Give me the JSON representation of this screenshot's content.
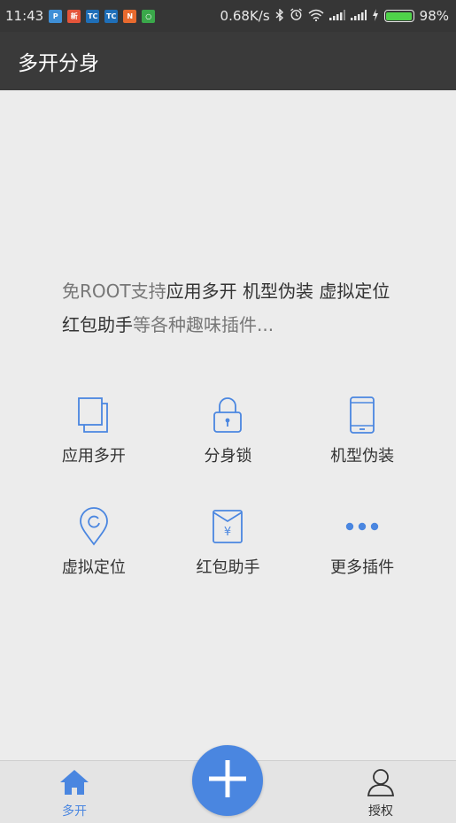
{
  "status_bar": {
    "time": "11:43",
    "net_speed": "0.68K/s",
    "battery_percent": "98%",
    "battery_level": 0.98,
    "notification_icons": [
      {
        "name": "pin-app-icon",
        "color": "#3f8fd6",
        "glyph": "P"
      },
      {
        "name": "news-app-icon",
        "color": "#e4543a",
        "glyph": "新"
      },
      {
        "name": "tc-app-icon",
        "color": "#1f6fb8",
        "glyph": "TC"
      },
      {
        "name": "tc-app-icon-2",
        "color": "#1f6fb8",
        "glyph": "TC"
      },
      {
        "name": "orange-app-icon",
        "color": "#e86a2e",
        "glyph": "N"
      },
      {
        "name": "green-app-icon",
        "color": "#3aa84a",
        "glyph": "○"
      }
    ]
  },
  "app_bar": {
    "title": "多开分身"
  },
  "intro": {
    "part1": "免ROOT支持",
    "part2": "应用多开 机型伪装 虚拟定位 红包助手",
    "part3": "等各种趣味插件..."
  },
  "features": [
    {
      "label": "应用多开",
      "icon": "copy-icon"
    },
    {
      "label": "分身锁",
      "icon": "lock-icon"
    },
    {
      "label": "机型伪装",
      "icon": "phone-icon"
    },
    {
      "label": "虚拟定位",
      "icon": "location-icon"
    },
    {
      "label": "红包助手",
      "icon": "red-envelope-icon"
    },
    {
      "label": "更多插件",
      "icon": "more-icon"
    }
  ],
  "bottom_nav": {
    "home_label": "多开",
    "auth_label": "授权"
  },
  "colors": {
    "accent": "#4a86e0",
    "app_bar": "#3a3a3a",
    "background": "#ececec"
  }
}
